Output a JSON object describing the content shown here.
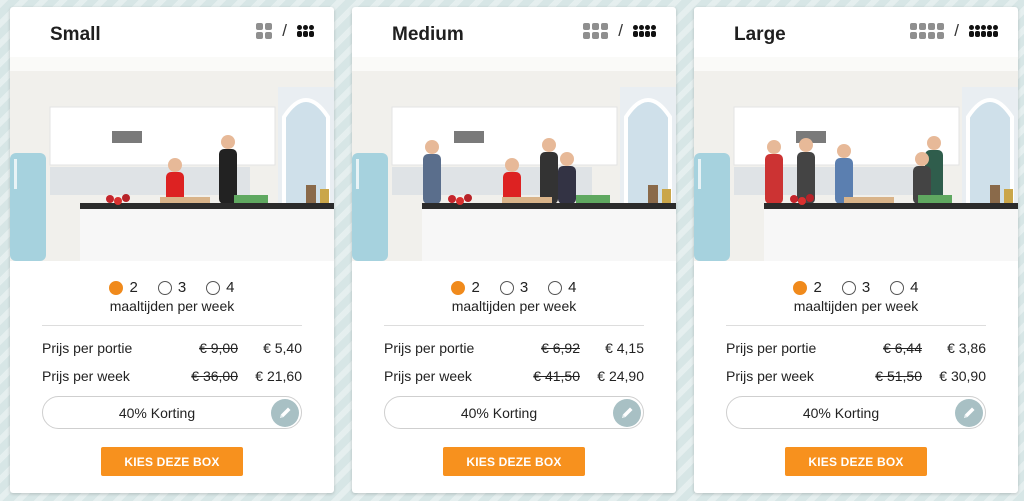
{
  "colors": {
    "accent": "#f7911e",
    "radio_selected": "#f08a1c",
    "edit_button": "#a8c0c4"
  },
  "cards": [
    {
      "title": "Small",
      "icons": [
        "two-person-icon",
        "family-icon"
      ],
      "radio_options": [
        "2",
        "3",
        "4"
      ],
      "selected_option": "2",
      "meals_label": "maaltijden per week",
      "rows": [
        {
          "label": "Prijs per portie",
          "old": "€ 9,00",
          "new": "€ 5,40"
        },
        {
          "label": "Prijs per week",
          "old": "€ 36,00",
          "new": "€ 21,60"
        }
      ],
      "discount": "40% Korting",
      "cta": "KIES DEZE BOX"
    },
    {
      "title": "Medium",
      "icons": [
        "three-person-icon",
        "family-icon"
      ],
      "radio_options": [
        "2",
        "3",
        "4"
      ],
      "selected_option": "2",
      "meals_label": "maaltijden per week",
      "rows": [
        {
          "label": "Prijs per portie",
          "old": "€ 6,92",
          "new": "€ 4,15"
        },
        {
          "label": "Prijs per week",
          "old": "€ 41,50",
          "new": "€ 24,90"
        }
      ],
      "discount": "40% Korting",
      "cta": "KIES DEZE BOX"
    },
    {
      "title": "Large",
      "icons": [
        "four-person-icon",
        "family-icon"
      ],
      "radio_options": [
        "2",
        "3",
        "4"
      ],
      "selected_option": "2",
      "meals_label": "maaltijden per week",
      "rows": [
        {
          "label": "Prijs per portie",
          "old": "€ 6,44",
          "new": "€ 3,86"
        },
        {
          "label": "Prijs per week",
          "old": "€ 51,50",
          "new": "€ 30,90"
        }
      ],
      "discount": "40% Korting",
      "cta": "KIES DEZE BOX"
    }
  ]
}
